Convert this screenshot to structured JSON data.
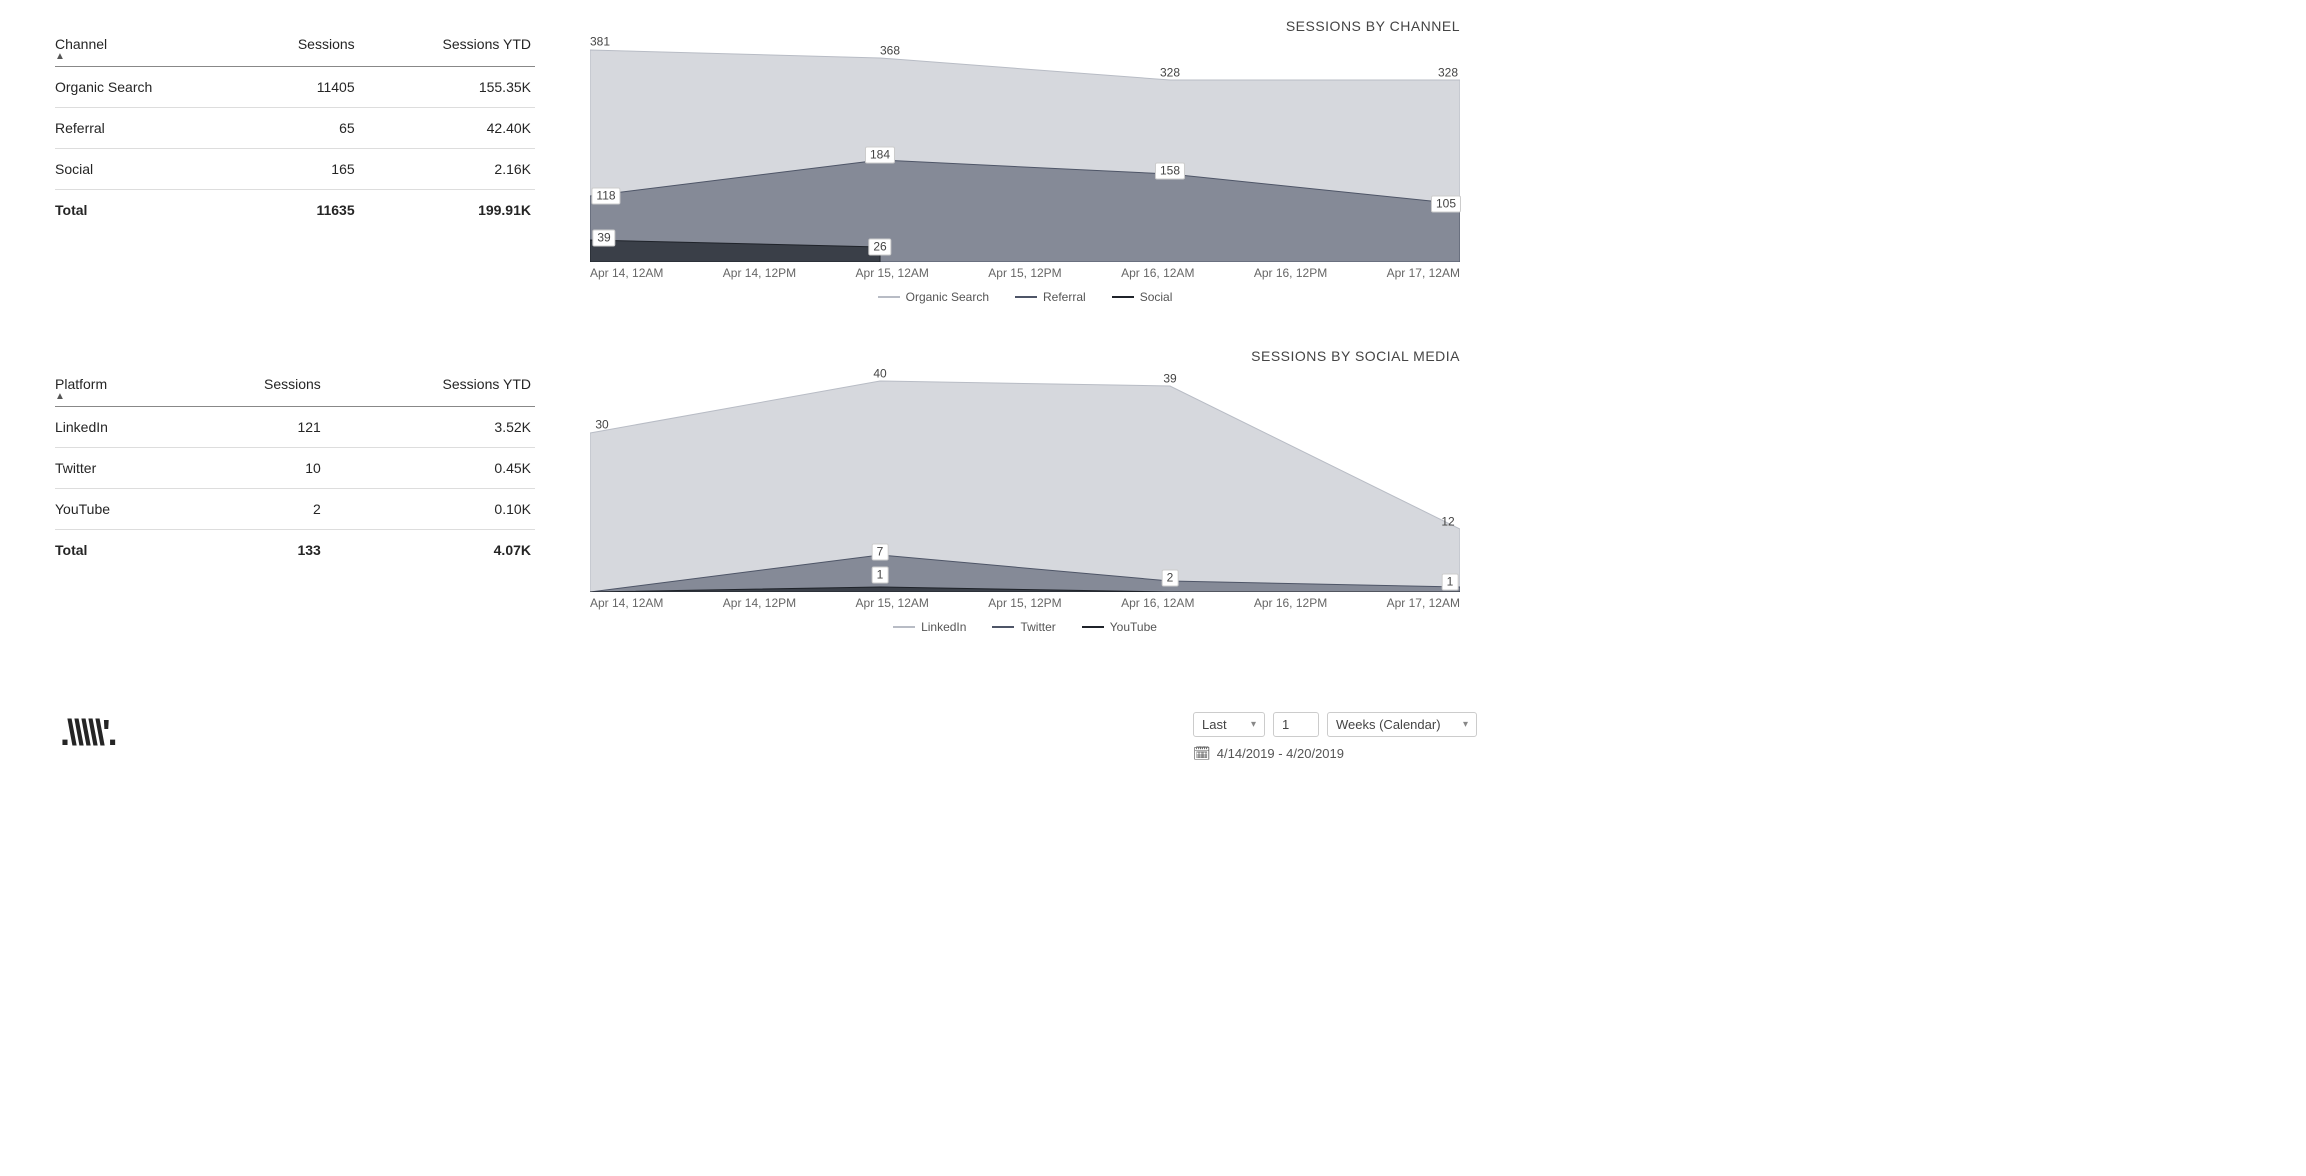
{
  "tables": {
    "channel": {
      "headers": [
        "Channel",
        "Sessions",
        "Sessions YTD"
      ],
      "rows": [
        {
          "name": "Organic Search",
          "sessions": "11405",
          "ytd": "155.35K"
        },
        {
          "name": "Referral",
          "sessions": "65",
          "ytd": "42.40K"
        },
        {
          "name": "Social",
          "sessions": "165",
          "ytd": "2.16K"
        }
      ],
      "total": {
        "label": "Total",
        "sessions": "11635",
        "ytd": "199.91K"
      }
    },
    "social": {
      "headers": [
        "Platform",
        "Sessions",
        "Sessions YTD"
      ],
      "rows": [
        {
          "name": "LinkedIn",
          "sessions": "121",
          "ytd": "3.52K"
        },
        {
          "name": "Twitter",
          "sessions": "10",
          "ytd": "0.45K"
        },
        {
          "name": "YouTube",
          "sessions": "2",
          "ytd": "0.10K"
        }
      ],
      "total": {
        "label": "Total",
        "sessions": "133",
        "ytd": "4.07K"
      }
    }
  },
  "chart_data": [
    {
      "type": "area",
      "title": "SESSIONS BY CHANNEL",
      "categories": [
        "Apr 14, 12AM",
        "Apr 14, 12PM",
        "Apr 15, 12AM",
        "Apr 15, 12PM",
        "Apr 16, 12AM",
        "Apr 16, 12PM",
        "Apr 17, 12AM"
      ],
      "series": [
        {
          "name": "Organic Search",
          "color": "#d6d8dd",
          "values": [
            381,
            null,
            368,
            null,
            328,
            null,
            328
          ]
        },
        {
          "name": "Referral",
          "color": "#6a7081",
          "values": [
            118,
            null,
            184,
            null,
            158,
            null,
            105
          ]
        },
        {
          "name": "Social",
          "color": "#2d323a",
          "values": [
            39,
            null,
            26,
            null,
            0,
            null,
            0
          ]
        }
      ],
      "ylim": [
        0,
        400
      ],
      "xlabel": "",
      "ylabel": ""
    },
    {
      "type": "area",
      "title": "SESSIONS BY SOCIAL MEDIA",
      "categories": [
        "Apr 14, 12AM",
        "Apr 14, 12PM",
        "Apr 15, 12AM",
        "Apr 15, 12PM",
        "Apr 16, 12AM",
        "Apr 16, 12PM",
        "Apr 17, 12AM"
      ],
      "series": [
        {
          "name": "LinkedIn",
          "color": "#d6d8dd",
          "values": [
            30,
            null,
            40,
            null,
            39,
            null,
            12
          ]
        },
        {
          "name": "Twitter",
          "color": "#6a7081",
          "values": [
            0,
            null,
            7,
            null,
            2,
            null,
            1
          ]
        },
        {
          "name": "YouTube",
          "color": "#2d323a",
          "values": [
            0,
            null,
            1,
            null,
            0,
            null,
            0
          ]
        }
      ],
      "ylim": [
        0,
        42
      ],
      "xlabel": "",
      "ylabel": ""
    }
  ],
  "controls": {
    "relative": "Last",
    "amount": "1",
    "unit": "Weeks (Calendar)",
    "daterange": "4/14/2019 - 4/20/2019"
  }
}
